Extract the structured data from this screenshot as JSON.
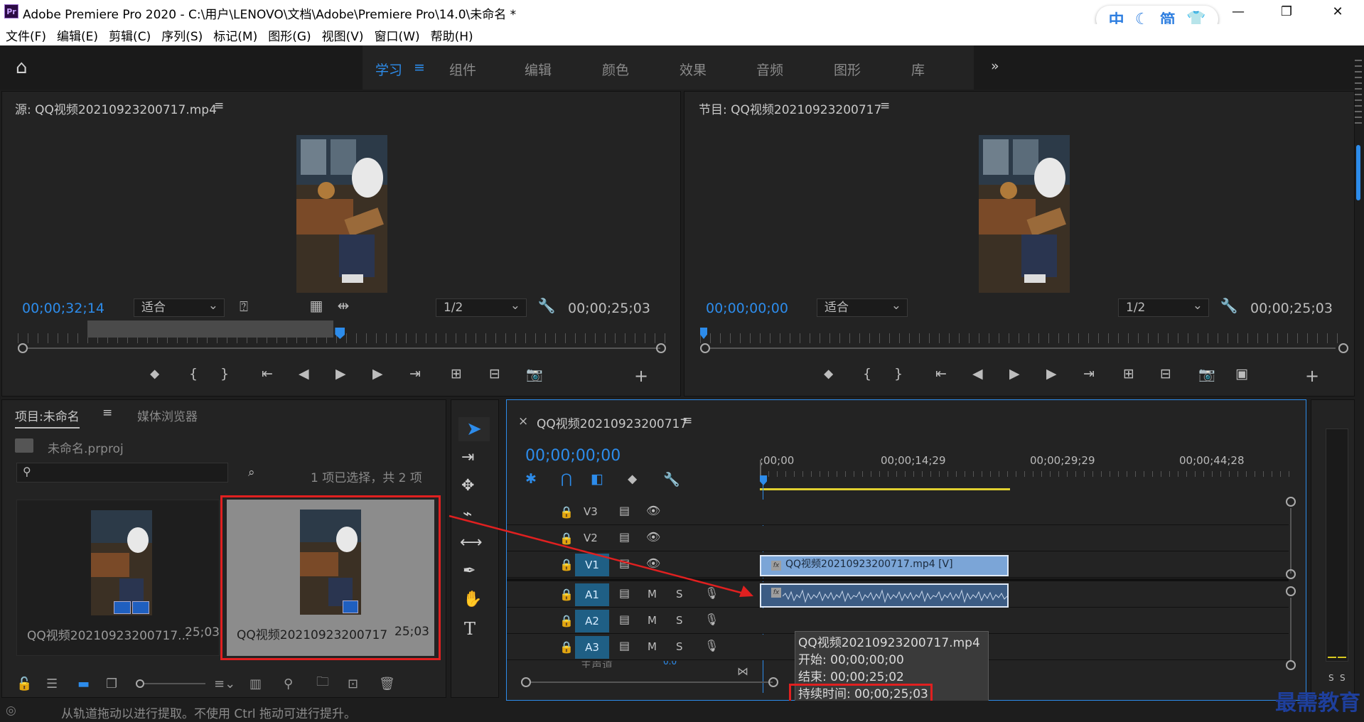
{
  "window": {
    "app_icon": "Pr",
    "title": "Adobe Premiere Pro 2020 - C:\\用户\\LENOVO\\文档\\Adobe\\Premiere Pro\\14.0\\未命名 *",
    "minimize": "—",
    "restore": "❐",
    "close": "✕"
  },
  "ime": {
    "items": [
      "中",
      "☾",
      "简",
      "👕"
    ]
  },
  "menu": [
    "文件(F)",
    "编辑(E)",
    "剪辑(C)",
    "序列(S)",
    "标记(M)",
    "图形(G)",
    "视图(V)",
    "窗口(W)",
    "帮助(H)"
  ],
  "workspaces": {
    "tabs": [
      "学习",
      "组件",
      "编辑",
      "颜色",
      "效果",
      "音频",
      "图形",
      "库"
    ],
    "active": "学习",
    "menu_icon": "≡",
    "more_icon": "»"
  },
  "source": {
    "title": "源: QQ视频20210923200717.mp4",
    "menu_icon": "≡",
    "timecode": "00;00;32;14",
    "fit": "适合",
    "resolution": "1/2",
    "duration": "00;00;25;03",
    "playhead_fraction": 0.495
  },
  "program": {
    "title": "节目: QQ视频20210923200717",
    "menu_icon": "≡",
    "timecode": "00;00;00;00",
    "fit": "适合",
    "resolution": "1/2",
    "duration": "00;00;25;03",
    "playhead_fraction": 0.0
  },
  "transport": {
    "marker": "⬥",
    "in": "{",
    "out": "}",
    "goto_in": "⇤",
    "step_back": "◀",
    "play": "▶",
    "step_fwd": "▶",
    "goto_out": "⇥",
    "insert": "⊞",
    "overwrite": "⊟",
    "export_frame": "📷",
    "compare": "▣",
    "add": "+"
  },
  "project": {
    "tab_project": "项目:未命名",
    "tab_media": "媒体浏览器",
    "file": "未命名.prproj",
    "selection_info": "1 项已选择，共 2 项",
    "items": [
      {
        "name": "QQ视频20210923200717...",
        "duration": "25;03"
      },
      {
        "name": "QQ视频20210923200717",
        "duration": "25;03"
      }
    ]
  },
  "timeline": {
    "close": "×",
    "title": "QQ视频20210923200717",
    "menu_icon": "≡",
    "timecode": "00;00;00;00",
    "ruler": [
      ";00;00",
      "00;00;14;29",
      "00;00;29;29",
      "00;00;44;28"
    ],
    "video_tracks": [
      "V3",
      "V2",
      "V1"
    ],
    "audio_tracks": [
      "A1",
      "A2",
      "A3"
    ],
    "mute": "M",
    "solo": "S",
    "master_label": "主声道",
    "master_value": "0.0",
    "clip_video": "QQ视频20210923200717.mp4 [V]",
    "fx": "fx"
  },
  "tooltip": {
    "name": "QQ视频20210923200717.mp4",
    "start": "开始: 00;00;00;00",
    "end": "结束: 00;00;25;02",
    "duration": "持续时间: 00;00;25;03"
  },
  "audio_meter": {
    "s1": "S",
    "s2": "S"
  },
  "status": "从轨道拖动以进行提取。不使用 Ctrl 拖动可进行提升。",
  "watermark": "最需教育",
  "colors": {
    "accent": "#2d8ceb",
    "highlight_red": "#e02020",
    "clip_video": "#7ba5d7",
    "clip_audio": "#3c5c84"
  }
}
